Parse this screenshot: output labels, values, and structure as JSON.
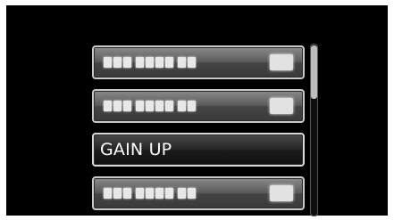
{
  "menu": {
    "items": [
      {
        "label": "",
        "blurred": true,
        "selected": false
      },
      {
        "label": "",
        "blurred": true,
        "selected": false
      },
      {
        "label": "GAIN UP",
        "blurred": false,
        "selected": true
      },
      {
        "label": "",
        "blurred": true,
        "selected": false
      }
    ]
  },
  "colors": {
    "screen_background": "#000000",
    "item_border": "#c9c9c9",
    "selected_text": "#ffffff"
  }
}
